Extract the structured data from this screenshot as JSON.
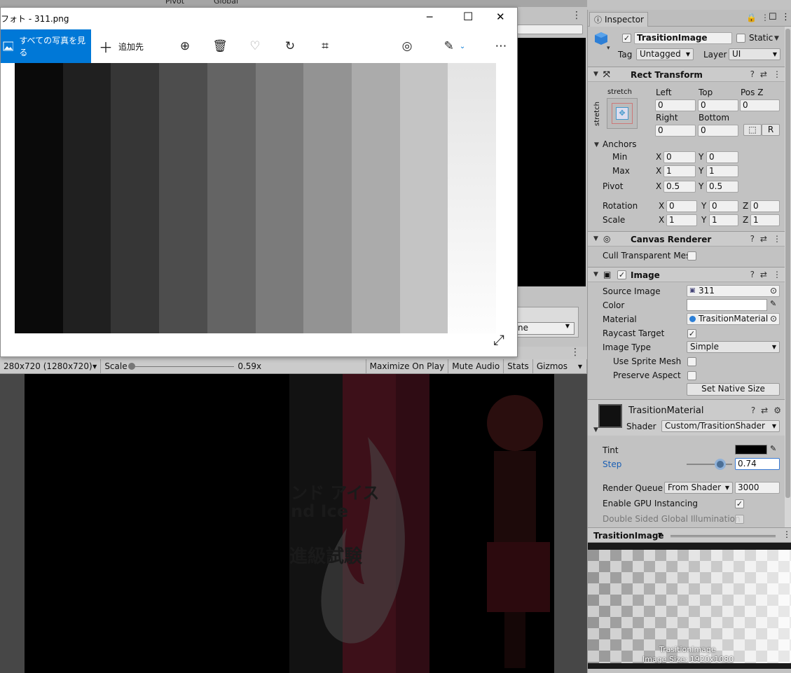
{
  "photo": {
    "title": "フォト - 311.png",
    "all_photos": "すべての写真を見る",
    "add_to": "追加先",
    "minimize": "─",
    "maximize": "☐",
    "close": "✕",
    "toolbar_icons": [
      "zoom-in-icon",
      "delete-icon",
      "favorite-icon",
      "rotate-icon",
      "crop-icon",
      "slideshow-icon",
      "edit-icon",
      "more-icon"
    ],
    "gray_steps": [
      "#0a0a0a",
      "#202020",
      "#363636",
      "#4d4d4d",
      "#646464",
      "#7b7b7b",
      "#939393",
      "#ababab",
      "#c4c4c4",
      "#dedede"
    ]
  },
  "unity": {
    "scene_drop_text": "ne",
    "resolution": "280x720 (1280x720)",
    "scale_label": "Scale",
    "scale_value": "0.59x",
    "maximize_on_play": "Maximize On Play",
    "mute_audio": "Mute Audio",
    "stats": "Stats",
    "gizmos": "Gizmos",
    "game_overlay": {
      "jp_title": "ンド アイス",
      "en_title": "nd Ice",
      "jp_sub": "進級試験"
    },
    "top_tabs": [
      "Pivot",
      "Global"
    ]
  },
  "inspector": {
    "tab": "Inspector",
    "object_name": "TrasitionImage",
    "static": "Static",
    "tag_label": "Tag",
    "tag_value": "Untagged",
    "layer_label": "Layer",
    "layer_value": "UI",
    "rect": {
      "title": "Rect Transform",
      "stretch_top": "stretch",
      "stretch_side": "stretch",
      "left_l": "Left",
      "top_l": "Top",
      "posz_l": "Pos Z",
      "left": "0",
      "top": "0",
      "posz": "0",
      "right_l": "Right",
      "bottom_l": "Bottom",
      "right": "0",
      "bottom": "0",
      "r_btn": "R",
      "anchors": "Anchors",
      "min": "Min",
      "max": "Max",
      "minx": "0",
      "miny": "0",
      "maxx": "1",
      "maxy": "1",
      "pivot": "Pivot",
      "pivx": "0.5",
      "pivy": "0.5",
      "rotation": "Rotation",
      "rotx": "0",
      "roty": "0",
      "rotz": "0",
      "scale": "Scale",
      "sx": "1",
      "sy": "1",
      "sz": "1",
      "x": "X",
      "y": "Y",
      "z": "Z"
    },
    "canvas_renderer": {
      "title": "Canvas Renderer",
      "cull": "Cull Transparent Mes"
    },
    "image": {
      "title": "Image",
      "source_image_l": "Source Image",
      "source_image": "311",
      "color_l": "Color",
      "material_l": "Material",
      "material": "TrasitionMaterial",
      "raycast_l": "Raycast Target",
      "image_type_l": "Image Type",
      "image_type": "Simple",
      "sprite_mesh_l": "Use Sprite Mesh",
      "preserve_l": "Preserve Aspect",
      "native_size": "Set Native Size"
    },
    "material": {
      "title": "TrasitionMaterial",
      "shader_l": "Shader",
      "shader": "Custom/TrasitionShader",
      "tint_l": "Tint",
      "step_l": "Step",
      "step": "0.74",
      "step_fraction": 0.74,
      "render_queue_l": "Render Queue",
      "render_queue_mode": "From Shader",
      "render_queue": "3000",
      "gpu_l": "Enable GPU Instancing",
      "double_l": "Double Sided Global Illumination"
    },
    "preview": {
      "title": "TrasitionImage",
      "caption1": "TrasitionImage",
      "caption2": "Image Size: 1920x1080"
    }
  }
}
